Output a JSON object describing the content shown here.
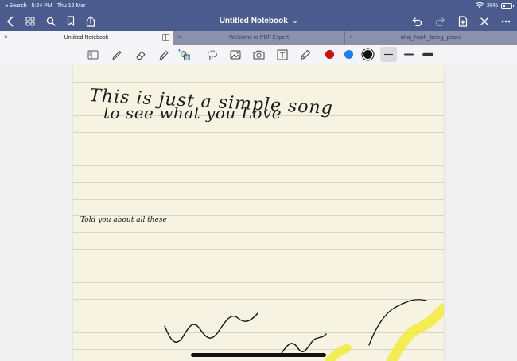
{
  "status_bar": {
    "back_label": "◂ Search",
    "time": "5:24 PM",
    "date": "Thu 12 Mar",
    "battery": "26%"
  },
  "nav": {
    "title": "Untitled Notebook",
    "title_chevron": "⌄"
  },
  "tabs": [
    {
      "label": "Untitled Notebook",
      "active": true
    },
    {
      "label": "Welcome to PDF Expert",
      "active": false
    },
    {
      "label": "nhat_hanh_being_peace",
      "active": false
    }
  ],
  "toolbar": {
    "tools": [
      "page-tool",
      "pen-tool",
      "eraser-tool",
      "highlighter-tool",
      "shapes-tool",
      "lasso-tool",
      "image-tool",
      "camera-tool",
      "text-tool",
      "stamp-tool"
    ],
    "colors": [
      "#cc1111",
      "#1a7ff0",
      "#111111"
    ],
    "selected_color": "#111111",
    "thicknesses": [
      "thin",
      "medium",
      "thick"
    ],
    "selected_thickness": "thin"
  },
  "notebook": {
    "handwriting": [
      "This is just a simple song",
      "to see what you Love",
      "Told you about all these"
    ]
  }
}
